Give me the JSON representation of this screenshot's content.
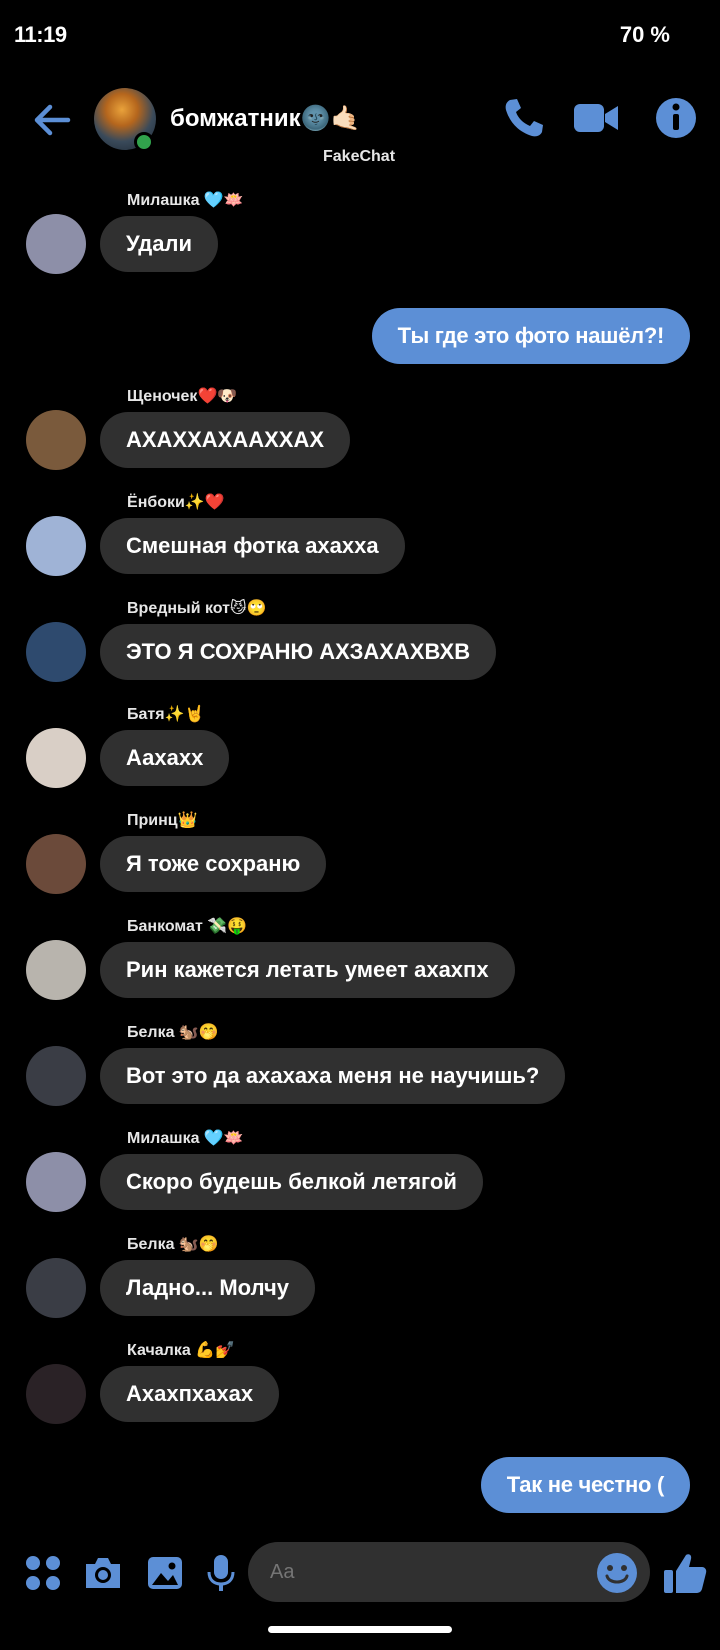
{
  "status_bar": {
    "time": "11:19",
    "battery": "70 %"
  },
  "header": {
    "title": "бомжатник🌚🤙🏻",
    "watermark": "FakeChat",
    "accent_color": "#5c8fd6",
    "icons": [
      "back-arrow-icon",
      "phone-icon",
      "video-camera-icon",
      "info-icon"
    ]
  },
  "messages": [
    {
      "type": "in",
      "sender": "Милашка 🩵🪷",
      "text": "Удали",
      "avatar_color": "#8d8fa8"
    },
    {
      "type": "out",
      "text": "Ты где это фото нашёл?!"
    },
    {
      "type": "in",
      "sender": "Щеночек❤️🐶",
      "text": "АХАХХАХААХХАХ",
      "avatar_color": "#7a5a3c"
    },
    {
      "type": "in",
      "sender": "Ёнбоки✨❤️",
      "text": "Смешная фотка ахахха",
      "avatar_color": "#9fb3d6"
    },
    {
      "type": "in",
      "sender": "Вредный кот😼🙄",
      "text": "ЭТО Я СОХРАНЮ АХЗАХАХВХВ",
      "avatar_color": "#2e4a6e"
    },
    {
      "type": "in",
      "sender": "Батя✨🤘",
      "text": "Аахахх",
      "avatar_color": "#d9cfc6"
    },
    {
      "type": "in",
      "sender": "Принц👑",
      "text": "Я тоже сохраню",
      "avatar_color": "#6b4a3a"
    },
    {
      "type": "in",
      "sender": "Банкомат 💸🤑",
      "text": "Рин кажется летать умеет ахахпх",
      "avatar_color": "#b8b4ad"
    },
    {
      "type": "in",
      "sender": "Белка 🐿️🤭",
      "text": "Вот это да ахахаха меня не научишь?",
      "avatar_color": "#3a3d45"
    },
    {
      "type": "in",
      "sender": "Милашка 🩵🪷",
      "text": "Скоро будешь белкой летягой",
      "avatar_color": "#8d8fa8"
    },
    {
      "type": "in",
      "sender": "Белка 🐿️🤭",
      "text": "Ладно... Молчу",
      "avatar_color": "#3a3d45"
    },
    {
      "type": "in",
      "sender": "Качалка 💪💅",
      "text": "Ахахпхахах",
      "avatar_color": "#2a2226"
    },
    {
      "type": "out",
      "text": "Так не честно ("
    }
  ],
  "composer": {
    "placeholder": "Aa",
    "icons": [
      "apps-icon",
      "camera-icon",
      "gallery-icon",
      "microphone-icon",
      "emoji-icon",
      "thumbs-up-icon"
    ]
  }
}
